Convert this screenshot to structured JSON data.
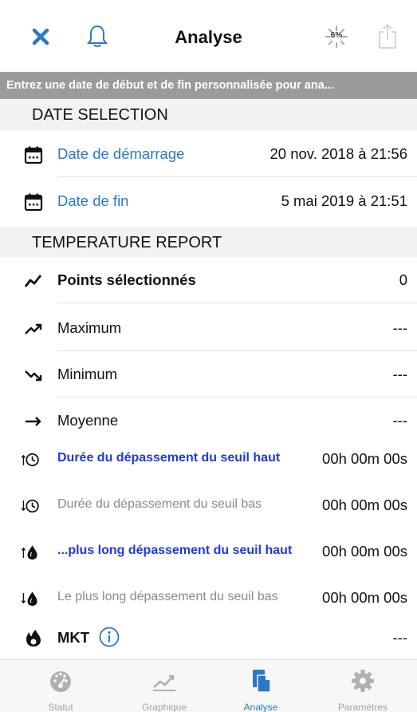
{
  "nav": {
    "title": "Analyse",
    "progress": "6%"
  },
  "banner": "Entrez une date de début et de fin personnalisée pour ana...",
  "date_section": {
    "header": "DATE SELECTION",
    "start": {
      "label": "Date de démarrage",
      "value": "20 nov. 2018 à 21:56"
    },
    "end": {
      "label": "Date de fin",
      "value": "5 mai 2019 à 21:51"
    }
  },
  "temp_section": {
    "header": "TEMPERATURE REPORT",
    "points": {
      "label": "Points sélectionnés",
      "value": "0"
    },
    "maximum": {
      "label": "Maximum",
      "value": "---"
    },
    "minimum": {
      "label": "Minimum",
      "value": "---"
    },
    "average": {
      "label": "Moyenne",
      "value": "---"
    },
    "high_duration": {
      "label": "Durée du dépassement du seuil haut",
      "value": "00h 00m 00s"
    },
    "low_duration": {
      "label": "Durée du dépassement du seuil bas",
      "value": "00h 00m 00s"
    },
    "longest_high": {
      "label": "...plus long dépassement du seuil haut",
      "value": "00h 00m 00s"
    },
    "longest_low": {
      "label": "Le plus long dépassement du seuil bas",
      "value": "00h 00m 00s"
    },
    "mkt": {
      "label": "MKT",
      "value": "---"
    }
  },
  "tabs": [
    {
      "label": "Statut",
      "icon": "gauge-icon"
    },
    {
      "label": "Graphique",
      "icon": "chart-icon"
    },
    {
      "label": "Analyse",
      "icon": "document-icon",
      "active": true
    },
    {
      "label": "Paramètres",
      "icon": "gear-icon"
    }
  ],
  "colors": {
    "accent": "#2a78c6",
    "dark_blue": "#1f3ad6",
    "banner": "#9b9b9b",
    "section_bg": "#f2f2f2"
  }
}
